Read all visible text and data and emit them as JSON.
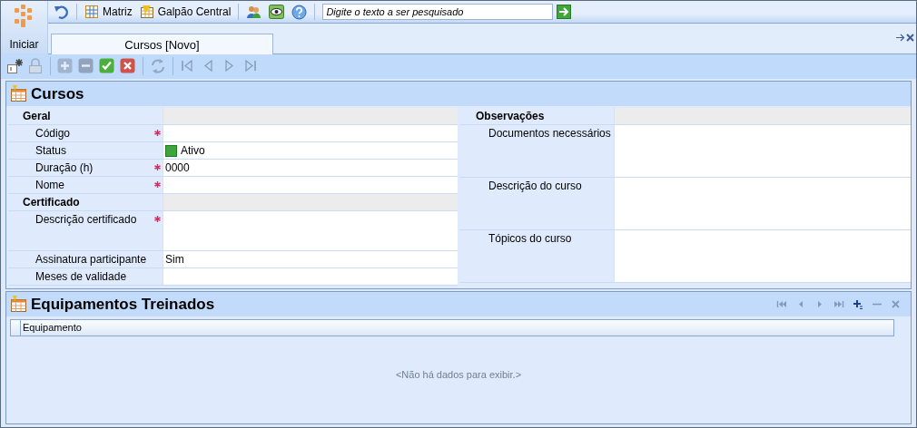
{
  "app_button": {
    "label": "Iniciar"
  },
  "quick_toolbar": {
    "items": [
      {
        "kind": "undo"
      },
      {
        "kind": "branch",
        "label": "Matriz"
      },
      {
        "kind": "warehouse",
        "label": "Galpão Central"
      },
      {
        "kind": "users"
      },
      {
        "kind": "eye"
      },
      {
        "kind": "help"
      }
    ],
    "search": {
      "placeholder": "Digite o texto a ser pesquisado"
    }
  },
  "tabs": [
    {
      "label": "Cursos [Novo]",
      "selected": true
    }
  ],
  "command_bar": [
    {
      "kind": "new",
      "disabled": false
    },
    {
      "kind": "lock",
      "disabled": true
    },
    {
      "kind": "add",
      "disabled": true
    },
    {
      "kind": "remove",
      "disabled": true
    },
    {
      "kind": "save",
      "disabled": false
    },
    {
      "kind": "cancel",
      "disabled": false
    },
    {
      "kind": "refresh",
      "disabled": true
    },
    {
      "kind": "first",
      "disabled": true
    },
    {
      "kind": "prev",
      "disabled": true
    },
    {
      "kind": "next",
      "disabled": true
    },
    {
      "kind": "last",
      "disabled": true
    }
  ],
  "form": {
    "title": "Cursos",
    "columns": [
      {
        "sections": [
          {
            "title": "Geral",
            "fields": [
              {
                "label": "Código",
                "kind": "text",
                "required": true
              },
              {
                "label": "Status",
                "kind": "status",
                "value": "Ativo",
                "required": false
              },
              {
                "label": "Duração (h)",
                "kind": "text",
                "value": "0000",
                "required": true
              },
              {
                "label": "Nome",
                "kind": "text",
                "required": true
              }
            ]
          },
          {
            "title": "Certificado",
            "fields": [
              {
                "label": "Descrição certificado",
                "kind": "memo",
                "required": true
              },
              {
                "label": "Assinatura participante",
                "kind": "text",
                "value": "Sim",
                "required": false
              },
              {
                "label": "Meses de validade",
                "kind": "text",
                "required": false
              }
            ]
          }
        ]
      },
      {
        "sections": [
          {
            "title": "Observações",
            "fields": [
              {
                "label": "Documentos necessários",
                "kind": "bigmemo",
                "required": false
              },
              {
                "label": "Descrição do curso",
                "kind": "bigmemo",
                "required": false
              },
              {
                "label": "Tópicos do curso",
                "kind": "bigmemo",
                "required": false
              }
            ]
          }
        ]
      }
    ]
  },
  "grid": {
    "title": "Equipamentos Treinados",
    "nav": [
      {
        "kind": "first",
        "disabled": true
      },
      {
        "kind": "prev",
        "disabled": true
      },
      {
        "kind": "next",
        "disabled": true
      },
      {
        "kind": "last",
        "disabled": true
      },
      {
        "kind": "add",
        "disabled": false
      },
      {
        "kind": "remove",
        "disabled": true
      },
      {
        "kind": "delete",
        "disabled": true
      }
    ],
    "columns": [
      "Equipamento"
    ],
    "empty_text": "<Não há dados para exibir.>"
  }
}
